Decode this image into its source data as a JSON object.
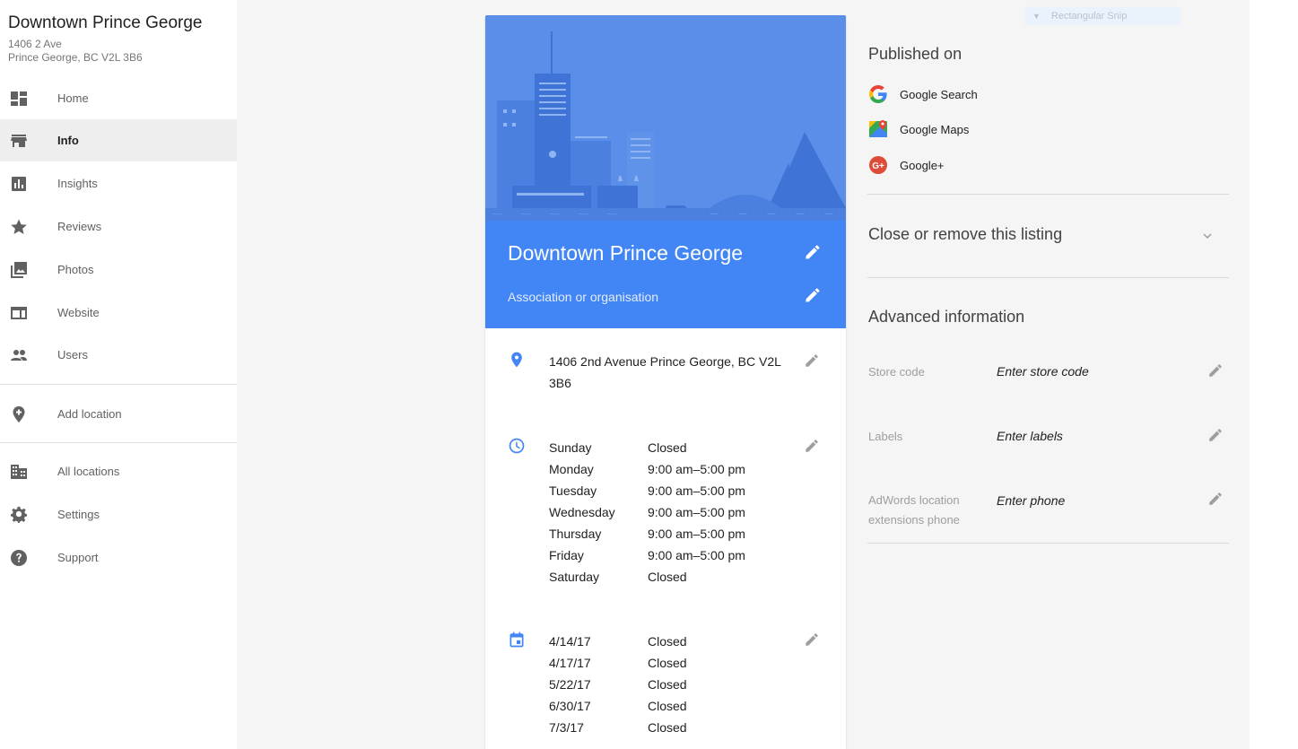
{
  "business": {
    "name": "Downtown Prince George",
    "address_line1": "1406 2 Ave",
    "address_line2": "Prince George, BC V2L 3B6"
  },
  "sidebar": {
    "items": [
      {
        "label": "Home",
        "icon": "dashboard-icon"
      },
      {
        "label": "Info",
        "icon": "store-icon",
        "active": true
      },
      {
        "label": "Insights",
        "icon": "insights-icon"
      },
      {
        "label": "Reviews",
        "icon": "star-icon"
      },
      {
        "label": "Photos",
        "icon": "photos-icon"
      },
      {
        "label": "Website",
        "icon": "website-icon"
      },
      {
        "label": "Users",
        "icon": "users-icon"
      },
      {
        "label": "Add location",
        "icon": "add-location-icon"
      },
      {
        "label": "All locations",
        "icon": "building-icon"
      },
      {
        "label": "Settings",
        "icon": "gear-icon"
      },
      {
        "label": "Support",
        "icon": "help-icon"
      }
    ]
  },
  "card": {
    "title": "Downtown Prince George",
    "category": "Association or organisation",
    "address": "1406 2nd Avenue Prince George, BC V2L 3B6",
    "hours": [
      {
        "day": "Sunday",
        "value": "Closed"
      },
      {
        "day": "Monday",
        "value": "9:00 am–5:00 pm"
      },
      {
        "day": "Tuesday",
        "value": "9:00 am–5:00 pm"
      },
      {
        "day": "Wednesday",
        "value": "9:00 am–5:00 pm"
      },
      {
        "day": "Thursday",
        "value": "9:00 am–5:00 pm"
      },
      {
        "day": "Friday",
        "value": "9:00 am–5:00 pm"
      },
      {
        "day": "Saturday",
        "value": "Closed"
      }
    ],
    "special_hours": [
      {
        "date": "4/14/17",
        "value": "Closed"
      },
      {
        "date": "4/17/17",
        "value": "Closed"
      },
      {
        "date": "5/22/17",
        "value": "Closed"
      },
      {
        "date": "6/30/17",
        "value": "Closed"
      },
      {
        "date": "7/3/17",
        "value": "Closed"
      }
    ]
  },
  "published": {
    "title": "Published on",
    "items": [
      {
        "label": "Google Search",
        "icon": "google-search-icon"
      },
      {
        "label": "Google Maps",
        "icon": "google-maps-icon"
      },
      {
        "label": "Google+",
        "icon": "google-plus-icon"
      }
    ]
  },
  "close_listing": {
    "title": "Close or remove this listing"
  },
  "advanced": {
    "title": "Advanced information",
    "fields": [
      {
        "label": "Store code",
        "placeholder": "Enter store code"
      },
      {
        "label": "Labels",
        "placeholder": "Enter labels"
      },
      {
        "label": "AdWords location extensions phone",
        "placeholder": "Enter phone"
      }
    ]
  },
  "overlay": {
    "snip_label": "Rectangular Snip"
  },
  "colors": {
    "brand_blue": "#4285f4",
    "hero_blue": "#5a8ee8"
  }
}
